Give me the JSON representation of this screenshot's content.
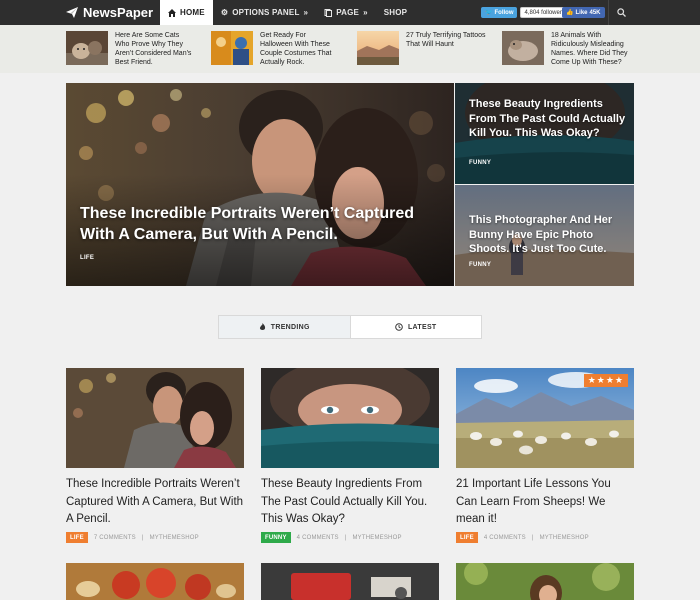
{
  "brand": {
    "name": "NewsPaper"
  },
  "nav": {
    "items": [
      {
        "label": "HOME",
        "icon": "home-icon"
      },
      {
        "label": "OPTIONS PANEL",
        "icon": "gear-icon"
      },
      {
        "label": "PAGE",
        "icon": "page-icon"
      },
      {
        "label": "SHOP"
      }
    ]
  },
  "social": {
    "twitter_label": "Follow",
    "followers": "4,804 followers",
    "facebook_label": "Like",
    "facebook_count": "45K"
  },
  "ticker": [
    {
      "title": "Here Are Some Cats Who Prove Why They Aren’t Considered Man's Best Friend."
    },
    {
      "title": "Get Ready For Halloween With These Couple Costumes That Actually Rock."
    },
    {
      "title": "27 Truly Terrifying Tattoos That Will Haunt"
    },
    {
      "title": "18 Animals With Ridiculously Misleading Names. Where Did They Come Up With These?"
    }
  ],
  "hero": {
    "main": {
      "title": "These Incredible Portraits Weren’t Captured With A Camera, But With A Pencil.",
      "category": "LIFE"
    },
    "side": [
      {
        "title": "These Beauty Ingredients From The Past Could Actually Kill You. This Was Okay?",
        "category": "FUNNY"
      },
      {
        "title": "This Photographer And Her Bunny Have Epic Photo Shoots. It's Just Too Cute.",
        "category": "FUNNY"
      }
    ]
  },
  "tabs": [
    {
      "label": "TRENDING",
      "icon": "flame-icon"
    },
    {
      "label": "LATEST",
      "icon": "clock-icon"
    }
  ],
  "articles": [
    {
      "title": "These Incredible Portraits Weren’t Captured With A Camera, But With A Pencil.",
      "category": "LIFE",
      "category_color": "#ef7e30",
      "comments": "7 COMMENTS",
      "author": "MYTHEMESHOP"
    },
    {
      "title": "These Beauty Ingredients From The Past Could Actually Kill You. This Was Okay?",
      "category": "FUNNY",
      "category_color": "#2eaa4a",
      "comments": "4 COMMENTS",
      "author": "MYTHEMESHOP"
    },
    {
      "title": "21 Important Life Lessons You Can Learn From Sheeps! We mean it!",
      "category": "LIFE",
      "category_color": "#ef7e30",
      "comments": "4 COMMENTS",
      "author": "MYTHEMESHOP",
      "rating": "★★★★",
      "rating_value": 4
    }
  ],
  "colors": {
    "topbar": "#2e2e2e",
    "accent_orange": "#ef7e30",
    "accent_green": "#2eaa4a",
    "twitter": "#4aa3df",
    "facebook": "#4267b2"
  }
}
